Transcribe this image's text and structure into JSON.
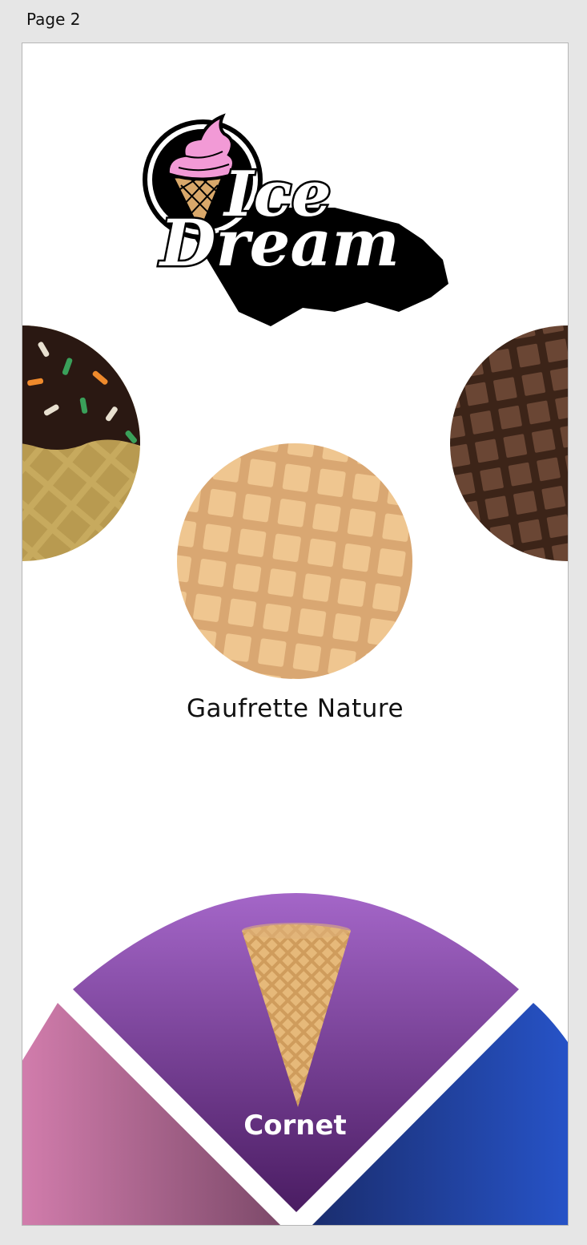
{
  "page": {
    "label": "Page 2"
  },
  "logo": {
    "line1": "Ice",
    "line2": "Dream"
  },
  "carousel": {
    "items": [
      {
        "name": "chocolate-sprinkles-waffle",
        "colors": [
          "#2a1812",
          "#c7aa5e"
        ]
      },
      {
        "name": "natural-waffle",
        "label": "Gaufrette Nature",
        "colors": [
          "#efc690",
          "#d9a772"
        ]
      },
      {
        "name": "chocolate-waffle",
        "colors": [
          "#5a3a2a",
          "#3c2418"
        ]
      }
    ],
    "selected_label": "Gaufrette Nature"
  },
  "wheel": {
    "center": {
      "label": "Cornet",
      "gradient": [
        "#a466c8",
        "#4a1c62"
      ]
    },
    "left": {
      "gradient": [
        "#d47eae",
        "#7d4a6a"
      ]
    },
    "right": {
      "gradient": [
        "#1a2d6e",
        "#2755cc"
      ]
    }
  }
}
